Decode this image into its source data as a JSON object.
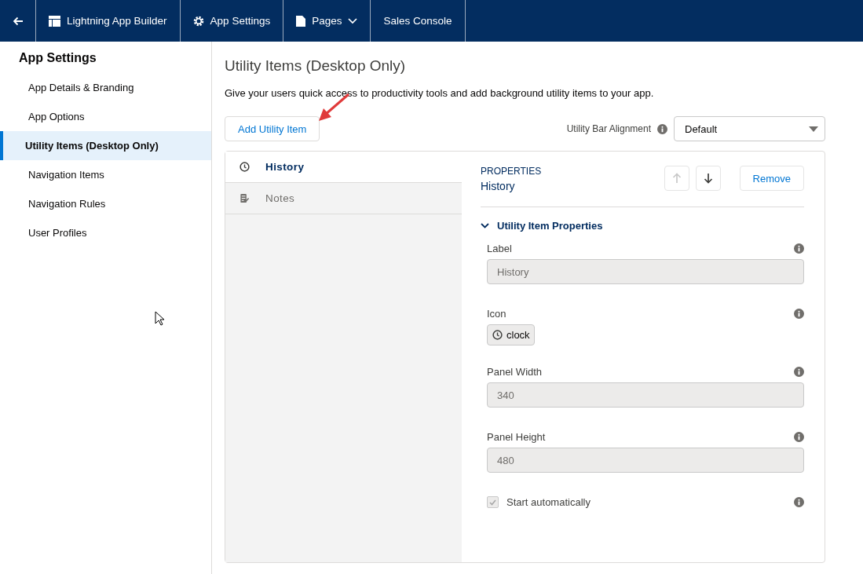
{
  "header": {
    "tabs": [
      {
        "label": "Lightning App Builder",
        "dropdown": false
      },
      {
        "label": "App Settings",
        "dropdown": false
      },
      {
        "label": "Pages",
        "dropdown": true
      },
      {
        "label": "Sales Console",
        "dropdown": false
      }
    ]
  },
  "sidebar": {
    "title": "App Settings",
    "items": [
      {
        "label": "App Details & Branding",
        "selected": false
      },
      {
        "label": "App Options",
        "selected": false
      },
      {
        "label": "Utility Items (Desktop Only)",
        "selected": true
      },
      {
        "label": "Navigation Items",
        "selected": false
      },
      {
        "label": "Navigation Rules",
        "selected": false
      },
      {
        "label": "User Profiles",
        "selected": false
      }
    ]
  },
  "main": {
    "title": "Utility Items (Desktop Only)",
    "description": "Give your users quick access to productivity tools and add background utility items to your app.",
    "add_button": "Add Utility Item",
    "alignment": {
      "label": "Utility Bar Alignment",
      "value": "Default"
    },
    "items": [
      {
        "label": "History",
        "selected": true
      },
      {
        "label": "Notes",
        "selected": false
      }
    ],
    "properties": {
      "heading": "PROPERTIES",
      "name": "History",
      "move_up": {
        "disabled": true
      },
      "move_down": {
        "disabled": false
      },
      "remove_button": "Remove",
      "section": {
        "title": "Utility Item Properties",
        "expanded": true
      },
      "fields": [
        {
          "kind": "text",
          "label": "Label",
          "value": "History",
          "disabled": true
        },
        {
          "kind": "icon",
          "label": "Icon",
          "value": "clock"
        },
        {
          "kind": "text",
          "label": "Panel Width",
          "value": "340",
          "disabled": true
        },
        {
          "kind": "text",
          "label": "Panel Height",
          "value": "480",
          "disabled": true
        },
        {
          "kind": "checkbox",
          "label": "Start automatically",
          "checked": true,
          "disabled": true
        }
      ]
    }
  }
}
